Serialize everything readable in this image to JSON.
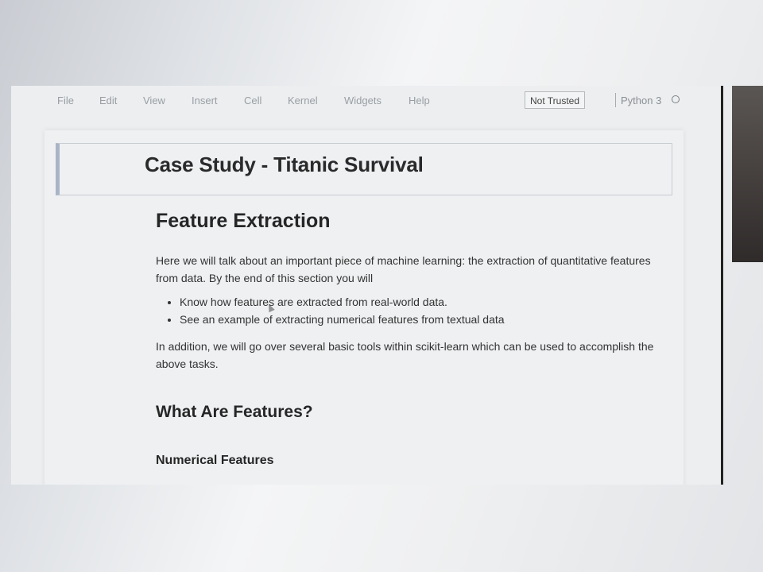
{
  "menubar": {
    "items": [
      "File",
      "Edit",
      "View",
      "Insert",
      "Cell",
      "Kernel",
      "Widgets",
      "Help"
    ],
    "trust_label": "Not Trusted",
    "kernel_label": "Python 3"
  },
  "notebook": {
    "title": "Case Study - Titanic Survival",
    "section_heading": "Feature Extraction",
    "intro": "Here we will talk about an important piece of machine learning: the extraction of quantitative features from data. By the end of this section you will",
    "bullets": [
      "Know how features are extracted from real-world data.",
      "See an example of extracting numerical features from textual data"
    ],
    "addition": "In addition, we will go over several basic tools within scikit-learn which can be used to accomplish the above tasks.",
    "subheading": "What Are Features?",
    "subsubheading": "Numerical Features"
  },
  "colors": {
    "selected_cell_border": "#a9b4c6",
    "menu_text": "#9a9ea3"
  }
}
